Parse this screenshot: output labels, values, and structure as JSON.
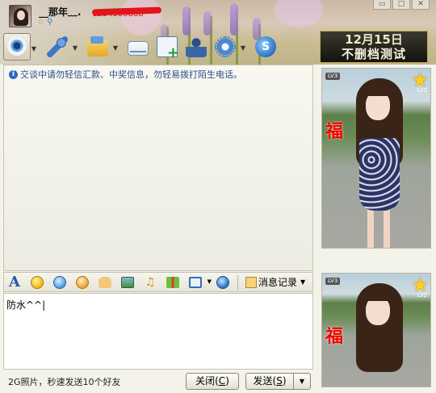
{
  "header": {
    "contact_name": "__那年﹏.",
    "contact_number": "1234566888"
  },
  "toolbar": {
    "items": [
      "video-call",
      "voice-call",
      "send-file",
      "send-mail",
      "create-note",
      "invite-contact",
      "app-settings",
      "qq-search"
    ]
  },
  "ad": {
    "line1": "12月15日",
    "line2": "不删档测试"
  },
  "history": {
    "safety_notice": "交谈中请勿轻信汇款、中奖信息，勿轻易拨打陌生电话。"
  },
  "side": {
    "level_badge": "LV3",
    "star_level": "LV2",
    "fu_char": "福"
  },
  "format_bar": {
    "font_label": "A",
    "history_label": "消息记录"
  },
  "input": {
    "value": "防水^^|"
  },
  "bottom": {
    "tip": "2G照片，秒速发送10个好友",
    "close_label": "关闭(",
    "close_key": "C",
    "close_end": ")",
    "send_label": "发送(",
    "send_key": "S",
    "send_end": ")"
  }
}
